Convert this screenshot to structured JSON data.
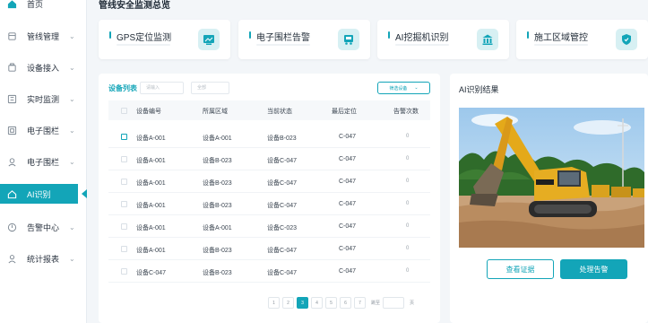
{
  "page_title": "管线安全监测总览",
  "sidebar": {
    "items": [
      {
        "label": "首页",
        "icon": "home-icon"
      },
      {
        "label": "管线管理",
        "icon": "pipeline-icon"
      },
      {
        "label": "设备接入",
        "icon": "device-icon"
      },
      {
        "label": "实时监测",
        "icon": "monitor-icon"
      },
      {
        "label": "电子围栏",
        "icon": "fence-icon"
      },
      {
        "label": "电子围栏",
        "icon": "location-icon"
      },
      {
        "label": "AI识别",
        "icon": "home-icon"
      },
      {
        "label": "告警中心",
        "icon": "alarm-icon"
      },
      {
        "label": "统计报表",
        "icon": "person-icon"
      }
    ]
  },
  "cards": [
    {
      "title": "GPS定位监测",
      "icon": "tablet-icon"
    },
    {
      "title": "电子围栏告警",
      "icon": "truck-icon"
    },
    {
      "title": "AI挖掘机识别",
      "icon": "building-icon"
    },
    {
      "title": "施工区域管控",
      "icon": "shield-icon"
    }
  ],
  "device_panel": {
    "title": "设备列表",
    "filter1_placeholder": "请输入",
    "filter2_placeholder": "全部",
    "filter_button": "筛选设备",
    "columns": [
      "设备编号",
      "所属区域",
      "当前状态",
      "最后定位",
      "告警次数"
    ],
    "rows": [
      [
        "设备A-001",
        "设备A-001",
        "设备B-023",
        "C-047",
        "0"
      ],
      [
        "设备A-001",
        "设备B-023",
        "设备C-047",
        "C-047",
        "0"
      ],
      [
        "设备A-001",
        "设备B-023",
        "设备C-047",
        "C-047",
        "0"
      ],
      [
        "设备A-001",
        "设备B-023",
        "设备C-047",
        "C-047",
        "0"
      ],
      [
        "设备A-001",
        "设备A-001",
        "设备C-023",
        "C-047",
        "0"
      ],
      [
        "设备A-001",
        "设备B-023",
        "设备C-047",
        "C-047",
        "0"
      ],
      [
        "设备C-047",
        "设备B-023",
        "设备C-047",
        "C-047",
        "0"
      ]
    ],
    "pagination": {
      "pages": [
        "1",
        "2",
        "3",
        "4",
        "5",
        "6",
        "7"
      ],
      "current": "3",
      "goto": "跳至",
      "suffix": "页"
    }
  },
  "ai_panel": {
    "title": "AI识别结果",
    "view_button": "查看证据",
    "handle_button": "处理告警"
  },
  "colors": {
    "accent": "#13a5b8",
    "bg": "#f3f6f9"
  }
}
